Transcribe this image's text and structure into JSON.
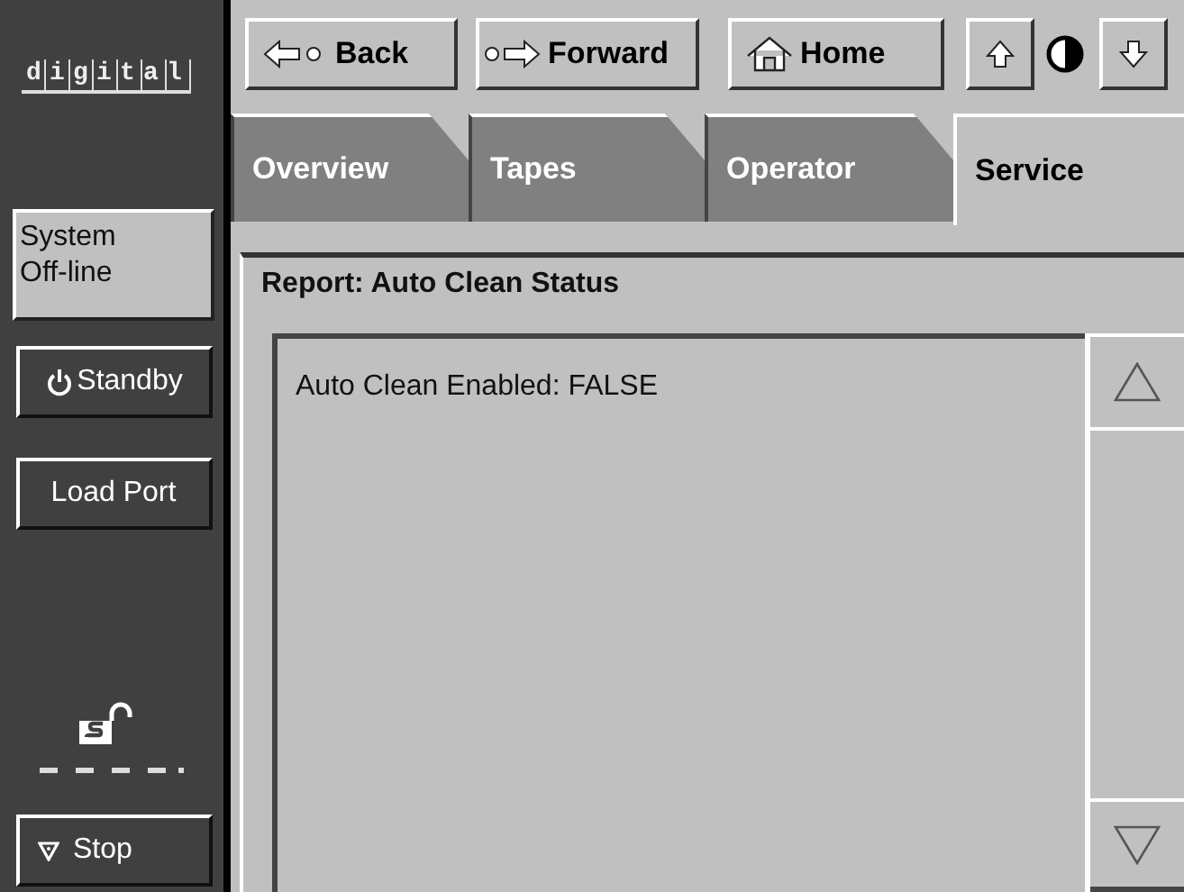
{
  "logo": "digital",
  "nav_buttons": [
    {
      "kind": "back",
      "label": "Back"
    },
    {
      "kind": "forward",
      "label": "Forward"
    },
    {
      "kind": "home",
      "label": "Home"
    }
  ],
  "tabs": [
    {
      "label": "Overview",
      "selected": false
    },
    {
      "label": "Tapes",
      "selected": false
    },
    {
      "label": "Operator",
      "selected": false
    },
    {
      "label": "Service",
      "selected": true
    }
  ],
  "sidebar": {
    "status": "System Off-line",
    "standby": "Standby",
    "load_port": "Load Port",
    "stop": "Stop"
  },
  "report": {
    "title": "Report: Auto Clean Status",
    "lines": [
      "Auto Clean Enabled: FALSE"
    ]
  }
}
